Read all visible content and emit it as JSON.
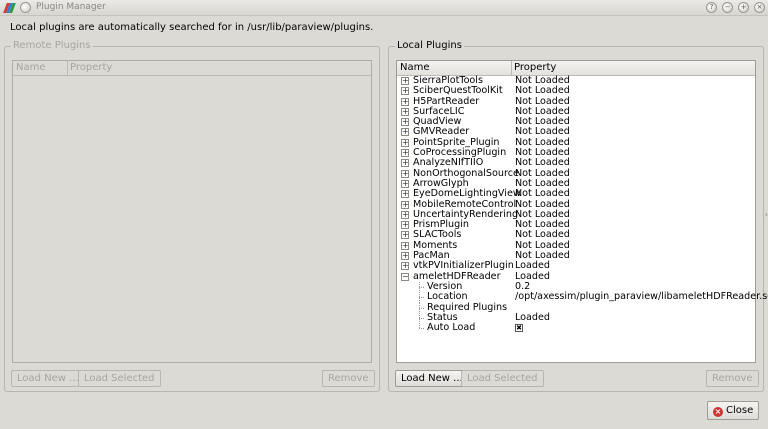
{
  "window": {
    "title": "Plugin Manager"
  },
  "info": "Local plugins are automatically searched for in /usr/lib/paraview/plugins.",
  "remote": {
    "title": "Remote Plugins",
    "columns": [
      "Name",
      "Property"
    ],
    "buttons": {
      "load_new": "Load New ...",
      "load_selected": "Load Selected",
      "remove": "Remove"
    }
  },
  "local": {
    "title": "Local Plugins",
    "columns": [
      "Name",
      "Property"
    ],
    "plugins": [
      {
        "name": "SierraPlotTools",
        "status": "Not Loaded"
      },
      {
        "name": "SciberQuestToolKit",
        "status": "Not Loaded"
      },
      {
        "name": "H5PartReader",
        "status": "Not Loaded"
      },
      {
        "name": "SurfaceLIC",
        "status": "Not Loaded"
      },
      {
        "name": "QuadView",
        "status": "Not Loaded"
      },
      {
        "name": "GMVReader",
        "status": "Not Loaded"
      },
      {
        "name": "PointSprite_Plugin",
        "status": "Not Loaded"
      },
      {
        "name": "CoProcessingPlugin",
        "status": "Not Loaded"
      },
      {
        "name": "AnalyzeNIfTIIO",
        "status": "Not Loaded"
      },
      {
        "name": "NonOrthogonalSource",
        "status": "Not Loaded"
      },
      {
        "name": "ArrowGlyph",
        "status": "Not Loaded"
      },
      {
        "name": "EyeDomeLightingView",
        "status": "Not Loaded"
      },
      {
        "name": "MobileRemoteControl",
        "status": "Not Loaded"
      },
      {
        "name": "UncertaintyRendering",
        "status": "Not Loaded"
      },
      {
        "name": "PrismPlugin",
        "status": "Not Loaded"
      },
      {
        "name": "SLACTools",
        "status": "Not Loaded"
      },
      {
        "name": "Moments",
        "status": "Not Loaded"
      },
      {
        "name": "PacMan",
        "status": "Not Loaded"
      },
      {
        "name": "vtkPVInitializerPlugin",
        "status": "Loaded"
      },
      {
        "name": "ameletHDFReader",
        "status": "Loaded",
        "expanded": true
      }
    ],
    "details": [
      {
        "name": "Version",
        "value": "0.2"
      },
      {
        "name": "Location",
        "value": "/opt/axessim/plugin_paraview/libameletHDFReader.so"
      },
      {
        "name": "Required Plugins",
        "value": ""
      },
      {
        "name": "Status",
        "value": "Loaded"
      },
      {
        "name": "Auto Load",
        "value": "",
        "checkbox": true,
        "checked": true
      }
    ],
    "buttons": {
      "load_new": "Load New ...",
      "load_selected": "Load Selected",
      "remove": "Remove"
    }
  },
  "close_label": "Close"
}
